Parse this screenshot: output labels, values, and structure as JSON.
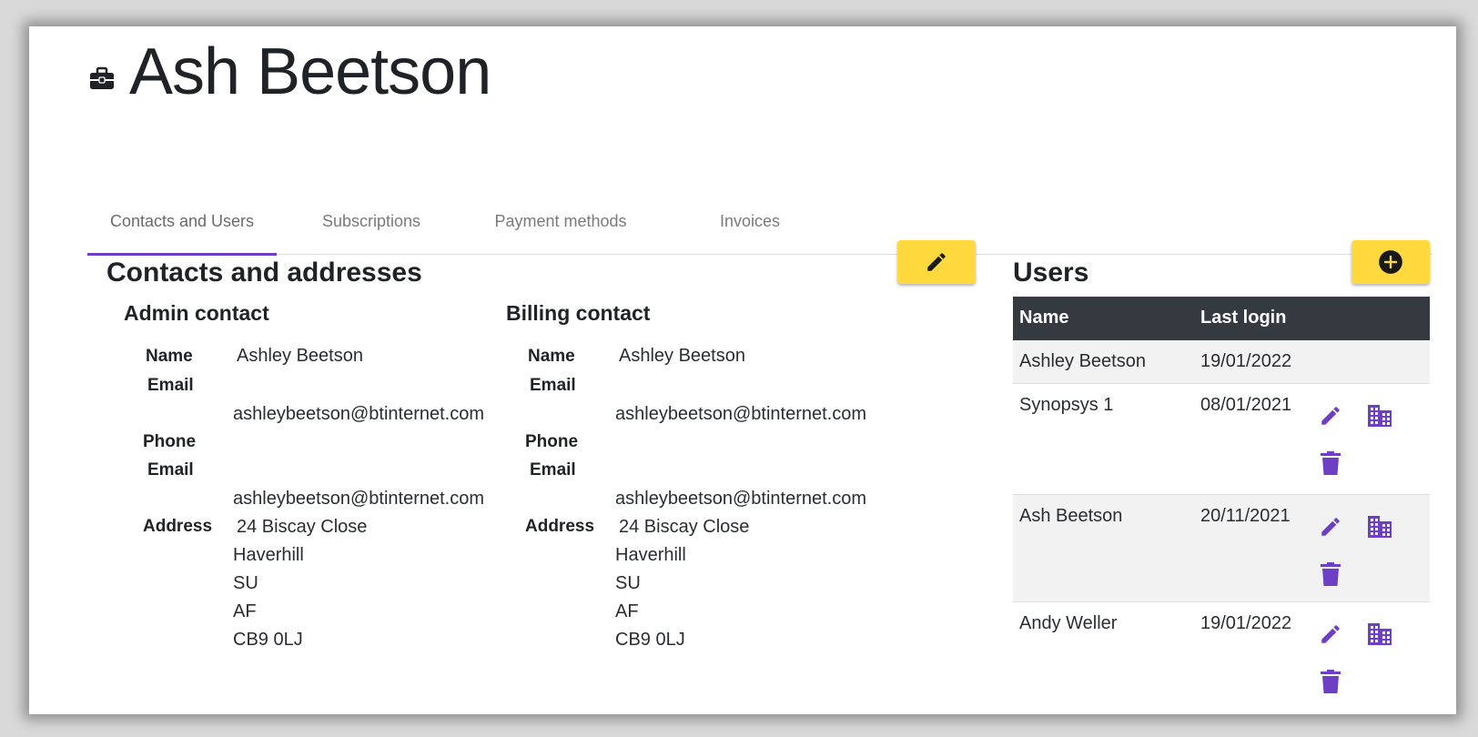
{
  "page": {
    "title": "Ash Beetson"
  },
  "tabs": [
    {
      "label": "Contacts and Users"
    },
    {
      "label": "Subscriptions"
    },
    {
      "label": "Payment methods"
    },
    {
      "label": "Invoices"
    }
  ],
  "contacts": {
    "heading": "Contacts and addresses",
    "admin": {
      "heading": "Admin contact",
      "name_label": "Name",
      "name": "Ashley Beetson",
      "email_label": "Email",
      "email": "ashleybeetson@btinternet.com",
      "phone_label": "Phone",
      "phone_email_label": "Email",
      "phone_email": "ashleybeetson@btinternet.com",
      "address_label": "Address",
      "address": [
        "24 Biscay Close",
        "Haverhill",
        "SU",
        "AF",
        "CB9 0LJ"
      ]
    },
    "billing": {
      "heading": "Billing contact",
      "name_label": "Name",
      "name": "Ashley Beetson",
      "email_label": "Email",
      "email": "ashleybeetson@btinternet.com",
      "phone_label": "Phone",
      "phone_email_label": "Email",
      "phone_email": "ashleybeetson@btinternet.com",
      "address_label": "Address",
      "address": [
        "24 Biscay Close",
        "Haverhill",
        "SU",
        "AF",
        "CB9 0LJ"
      ]
    }
  },
  "users": {
    "heading": "Users",
    "columns": {
      "name": "Name",
      "last_login": "Last login"
    },
    "rows": [
      {
        "name": "Ashley Beetson",
        "last_login": "19/01/2022"
      },
      {
        "name": "Synopsys 1",
        "last_login": "08/01/2021"
      },
      {
        "name": "Ash Beetson",
        "last_login": "20/11/2021"
      },
      {
        "name": "Andy Weller",
        "last_login": "19/01/2022"
      }
    ]
  },
  "colors": {
    "accent": "#6d3fc4",
    "button": "#ffd93d",
    "table_header": "#343a40",
    "row_alt": "#f2f2f2"
  },
  "icons": [
    "briefcase-icon",
    "pencil-icon",
    "plus-circle-icon",
    "edit-icon",
    "building-icon",
    "trash-icon"
  ]
}
